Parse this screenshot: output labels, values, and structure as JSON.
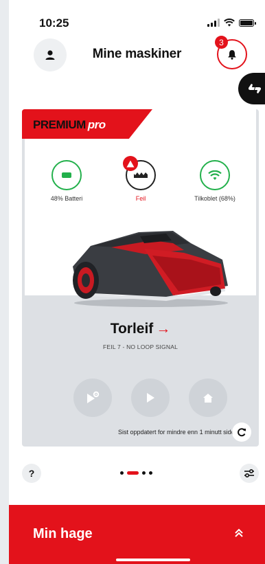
{
  "status_bar": {
    "time": "10:25"
  },
  "header": {
    "title": "Mine maskiner",
    "notification_count": "3"
  },
  "card": {
    "brand_badge": {
      "main": "PREMIUM",
      "suffix": "pro"
    },
    "stats": [
      {
        "label": "48% Batteri",
        "icon": "battery-icon",
        "color": "#22b04b",
        "value_percent": 48
      },
      {
        "label": "Feil",
        "icon": "mower-status-icon",
        "color": "#e3121b"
      },
      {
        "label": "Tilkoblet (68%)",
        "icon": "wifi-icon",
        "color": "#22b04b",
        "value_percent": 68
      }
    ],
    "mower_name": "Torleif",
    "name_arrow": "→",
    "error_message": "FEIL 7 - NO LOOP SIGNAL",
    "controls": [
      {
        "icon": "mow-settings-icon"
      },
      {
        "icon": "play-icon"
      },
      {
        "icon": "home-icon"
      }
    ],
    "last_updated": "Sist oppdatert for mindre enn 1 minutt siden."
  },
  "bottom": {
    "help_label": "?",
    "page_count": 4,
    "active_page": 2
  },
  "garden_bar": {
    "title": "Min hage"
  },
  "colors": {
    "accent": "#e3121b",
    "ok": "#22b04b",
    "card_bg": "#dde0e4"
  }
}
